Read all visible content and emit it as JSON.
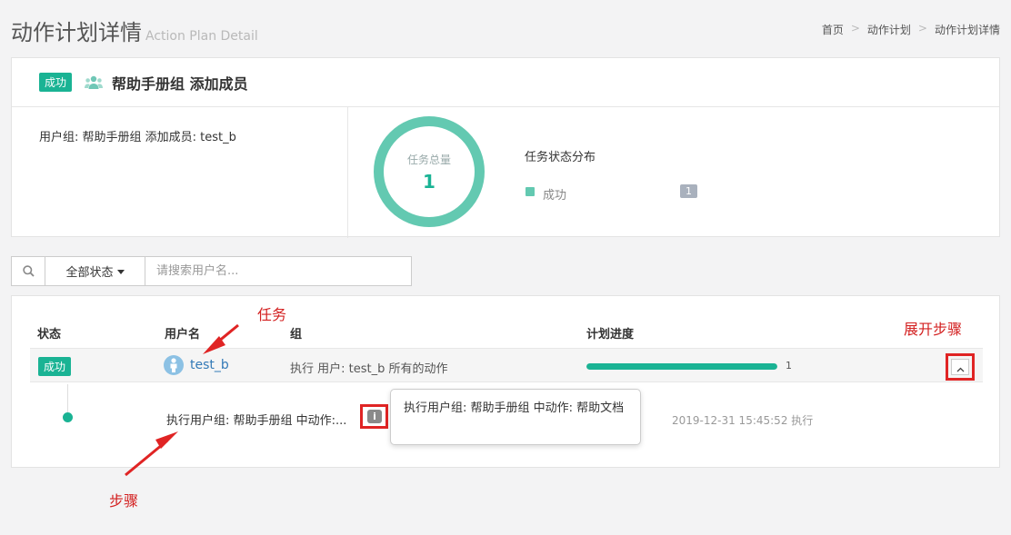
{
  "header": {
    "title": "动作计划详情",
    "subtitle": "Action Plan Detail",
    "breadcrumb": [
      "首页",
      "动作计划",
      "动作计划详情"
    ],
    "breadcrumb_sep": ">"
  },
  "plan": {
    "status_badge": "成功",
    "title": "帮助手册组 添加成员",
    "description": "用户组: 帮助手册组 添加成员: test_b",
    "total_label": "任务总量",
    "total_value": "1",
    "distribution_title": "任务状态分布",
    "legend": {
      "label": "成功",
      "count": "1",
      "color": "#63c9b1"
    }
  },
  "filter": {
    "status_select": "全部状态",
    "search_placeholder": "请搜索用户名..."
  },
  "table": {
    "headers": {
      "status": "状态",
      "username": "用户名",
      "group": "组",
      "progress": "计划进度"
    },
    "row": {
      "status": "成功",
      "username": "test_b",
      "group": "执行 用户: test_b 所有的动作",
      "progress_fraction": 1.0,
      "progress_value": "1"
    },
    "step": {
      "text": "执行用户组: 帮助手册组 中动作:...",
      "time": "2019-12-31 15:45:52 执行",
      "tooltip": "执行用户组: 帮助手册组 中动作: 帮助文档"
    }
  },
  "annotations": {
    "task": "任务",
    "expand_steps": "展开步骤",
    "step": "步骤",
    "color": "#d32020"
  }
}
